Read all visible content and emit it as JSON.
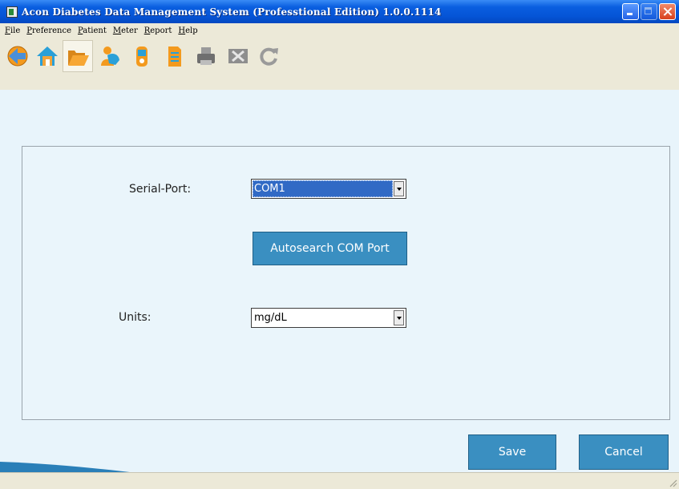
{
  "window": {
    "title": "Acon Diabetes Data Management System (Professtional Edition) 1.0.0.1114"
  },
  "menu": [
    {
      "accel": "F",
      "rest": "ile"
    },
    {
      "accel": "P",
      "rest": "reference"
    },
    {
      "accel": "P",
      "rest": "atient"
    },
    {
      "accel": "M",
      "rest": "eter"
    },
    {
      "accel": "R",
      "rest": "eport"
    },
    {
      "accel": "H",
      "rest": "elp"
    }
  ],
  "toolbar": {
    "icons": [
      "back-arrow-icon",
      "home-icon",
      "open-folder-icon",
      "patient-icon",
      "meter-icon",
      "report-icon",
      "printer-icon",
      "excel-export-icon",
      "refresh-icon"
    ],
    "active": "open-folder-icon"
  },
  "settings": {
    "serial_port_label": "Serial-Port:",
    "serial_port_value": "COM1",
    "autosearch_label": "Autosearch COM Port",
    "units_label": "Units:",
    "units_value": "mg/dL"
  },
  "actions": {
    "save_label": "Save",
    "cancel_label": "Cancel"
  },
  "colors": {
    "titlebar": "#0554d6",
    "accent_button": "#3a8fc1",
    "selection": "#316ac5",
    "background": "#e8f4fb"
  }
}
